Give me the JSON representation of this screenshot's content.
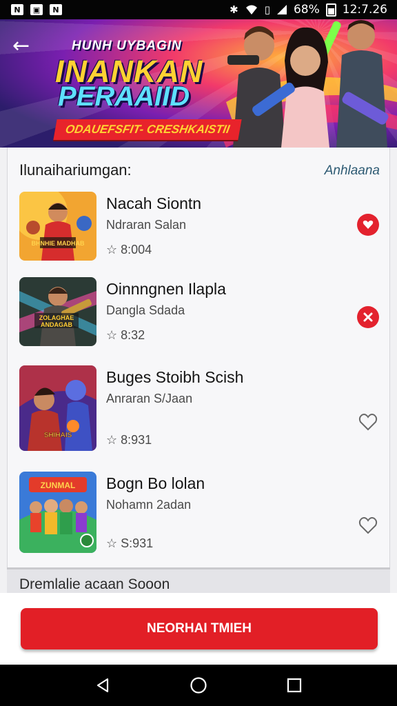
{
  "status_bar": {
    "battery_percent": "68%",
    "time": "12:7.26",
    "notification_icons": [
      "n-icon",
      "image-icon",
      "n-icon"
    ]
  },
  "banner": {
    "kicker": "HUNH UYBAGIN",
    "title_line1": "INANKAN",
    "title_line2": "PERAAIID",
    "ribbon": "ODAUEFSFIT- CRESHKAISTII"
  },
  "section": {
    "title": "Ilunaihariumgan:",
    "link": "Anhlaana"
  },
  "games": [
    {
      "name": "Nacah Siontn",
      "author": "Ndraran Salan",
      "stat": "☆ 8:004",
      "thumb_caption": "BHNHIE MADHAB",
      "action": "heart"
    },
    {
      "name": "Oinnngnen Ilapla",
      "author": "Dangla Sdada",
      "stat": "☆ 8:32",
      "thumb_caption": "ZOLAGHAE ANDAGAB",
      "action": "close"
    },
    {
      "name": "Buges Stoibh Scish",
      "author": "Anraran S/Jaan",
      "stat": "☆ 8:931",
      "thumb_caption": "SHIHAIS",
      "action": "outline"
    },
    {
      "name": "Bogn Bo lolan",
      "author": "Nohamn 2adan",
      "stat": "☆ S:931",
      "thumb_caption": "ZUNMAL",
      "action": "outline"
    }
  ],
  "notice": "Dremlalie acaan Sooon",
  "primary_button": "NEORHAI TMIEH",
  "colors": {
    "accent_red": "#e21f26",
    "link": "#2d5a73"
  }
}
